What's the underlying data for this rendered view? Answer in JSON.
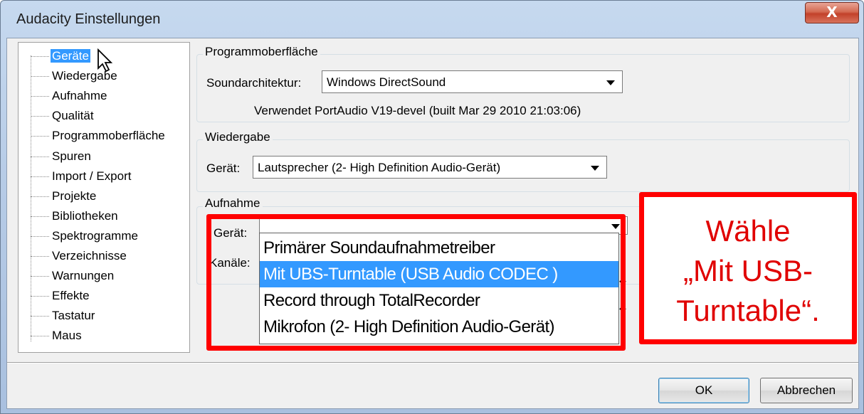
{
  "window": {
    "title": "Audacity Einstellungen",
    "close_label": "X"
  },
  "tree": {
    "items": [
      "Geräte",
      "Wiedergabe",
      "Aufnahme",
      "Qualität",
      "Programmoberfläche",
      "Spuren",
      "Import / Export",
      "Projekte",
      "Bibliotheken",
      "Spektrogramme",
      "Verzeichnisse",
      "Warnungen",
      "Effekte",
      "Tastatur",
      "Maus"
    ],
    "selected": "Geräte"
  },
  "interface_group": {
    "title": "Programmoberfläche",
    "host_label": "Soundarchitektur:",
    "host_value": "Windows DirectSound",
    "portaudio_info": "Verwendet PortAudio V19-devel (built Mar 29 2010 21:03:06)"
  },
  "playback_group": {
    "title": "Wiedergabe",
    "device_label": "Gerät:",
    "device_value": "Lautsprecher (2- High Definition Audio-Gerät)"
  },
  "recording_group": {
    "title": "Aufnahme",
    "device_label": "Gerät:",
    "channels_label": "Kanäle:",
    "options": [
      "Primärer Soundaufnahmetreiber",
      "Mit UBS-Turntable (USB Audio CODEC )",
      "Record through TotalRecorder",
      "Mikrofon (2- High Definition Audio-Gerät)"
    ],
    "highlighted_index": 1
  },
  "annotation": {
    "line1": "Wähle",
    "line2": "„Mit USB-",
    "line3": "Turntable“.",
    "color": "#e00000"
  },
  "buttons": {
    "ok": "OK",
    "cancel": "Abbrechen"
  }
}
